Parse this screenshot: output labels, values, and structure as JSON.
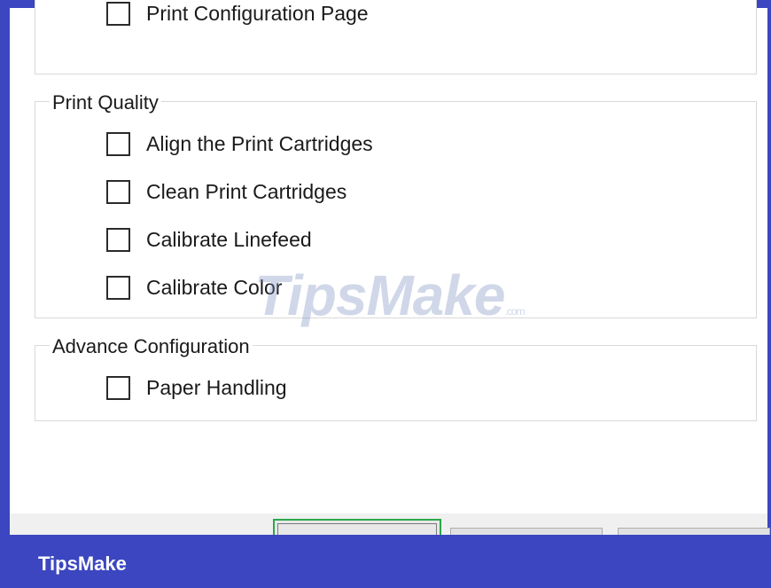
{
  "top_group": {
    "options": [
      {
        "label": "Print Configuration Page",
        "checked": false
      }
    ]
  },
  "print_quality": {
    "legend": "Print Quality",
    "options": [
      {
        "label": "Align the Print Cartridges",
        "checked": false
      },
      {
        "label": "Clean Print Cartridges",
        "checked": false
      },
      {
        "label": "Calibrate Linefeed",
        "checked": false
      },
      {
        "label": "Calibrate Color",
        "checked": false
      }
    ]
  },
  "advance_configuration": {
    "legend": "Advance Configuration",
    "options": [
      {
        "label": "Paper Handling",
        "checked": false
      }
    ]
  },
  "watermark": {
    "text": "TipsMake",
    "suffix": ".com"
  },
  "brand": {
    "name": "TipsMake"
  },
  "colors": {
    "frame": "#3b46c0",
    "primary_button_border": "#2aa84a"
  }
}
